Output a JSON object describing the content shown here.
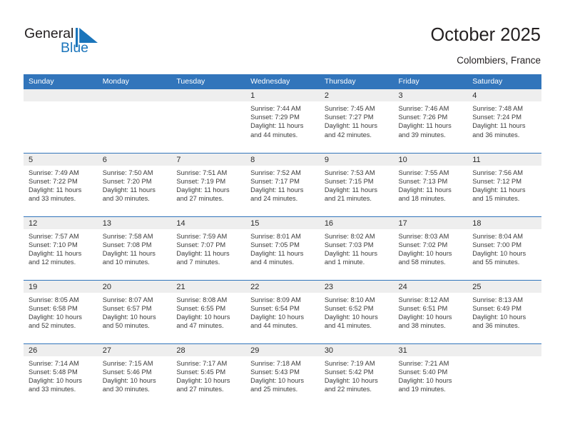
{
  "brand": {
    "name_part1": "General",
    "name_part2": "Blue",
    "logo_icon": "blue-flag-triangle-icon",
    "color_dark": "#231f20",
    "color_blue": "#1b75bb"
  },
  "header": {
    "title": "October 2025",
    "location": "Colombiers, France"
  },
  "theme": {
    "header_blue": "#3275bb",
    "daynum_band": "#eeeeee",
    "text": "#3b3b3b"
  },
  "weekdays": [
    "Sunday",
    "Monday",
    "Tuesday",
    "Wednesday",
    "Thursday",
    "Friday",
    "Saturday"
  ],
  "labels": {
    "sunrise_prefix": "Sunrise:",
    "sunset_prefix": "Sunset:",
    "daylight_prefix": "Daylight:"
  },
  "weeks": [
    [
      {
        "day": "",
        "empty": true
      },
      {
        "day": "",
        "empty": true
      },
      {
        "day": "",
        "empty": true
      },
      {
        "day": "1",
        "sunrise": "Sunrise: 7:44 AM",
        "sunset": "Sunset: 7:29 PM",
        "daylight_line1": "Daylight: 11 hours",
        "daylight_line2": "and 44 minutes."
      },
      {
        "day": "2",
        "sunrise": "Sunrise: 7:45 AM",
        "sunset": "Sunset: 7:27 PM",
        "daylight_line1": "Daylight: 11 hours",
        "daylight_line2": "and 42 minutes."
      },
      {
        "day": "3",
        "sunrise": "Sunrise: 7:46 AM",
        "sunset": "Sunset: 7:26 PM",
        "daylight_line1": "Daylight: 11 hours",
        "daylight_line2": "and 39 minutes."
      },
      {
        "day": "4",
        "sunrise": "Sunrise: 7:48 AM",
        "sunset": "Sunset: 7:24 PM",
        "daylight_line1": "Daylight: 11 hours",
        "daylight_line2": "and 36 minutes."
      }
    ],
    [
      {
        "day": "5",
        "sunrise": "Sunrise: 7:49 AM",
        "sunset": "Sunset: 7:22 PM",
        "daylight_line1": "Daylight: 11 hours",
        "daylight_line2": "and 33 minutes."
      },
      {
        "day": "6",
        "sunrise": "Sunrise: 7:50 AM",
        "sunset": "Sunset: 7:20 PM",
        "daylight_line1": "Daylight: 11 hours",
        "daylight_line2": "and 30 minutes."
      },
      {
        "day": "7",
        "sunrise": "Sunrise: 7:51 AM",
        "sunset": "Sunset: 7:19 PM",
        "daylight_line1": "Daylight: 11 hours",
        "daylight_line2": "and 27 minutes."
      },
      {
        "day": "8",
        "sunrise": "Sunrise: 7:52 AM",
        "sunset": "Sunset: 7:17 PM",
        "daylight_line1": "Daylight: 11 hours",
        "daylight_line2": "and 24 minutes."
      },
      {
        "day": "9",
        "sunrise": "Sunrise: 7:53 AM",
        "sunset": "Sunset: 7:15 PM",
        "daylight_line1": "Daylight: 11 hours",
        "daylight_line2": "and 21 minutes."
      },
      {
        "day": "10",
        "sunrise": "Sunrise: 7:55 AM",
        "sunset": "Sunset: 7:13 PM",
        "daylight_line1": "Daylight: 11 hours",
        "daylight_line2": "and 18 minutes."
      },
      {
        "day": "11",
        "sunrise": "Sunrise: 7:56 AM",
        "sunset": "Sunset: 7:12 PM",
        "daylight_line1": "Daylight: 11 hours",
        "daylight_line2": "and 15 minutes."
      }
    ],
    [
      {
        "day": "12",
        "sunrise": "Sunrise: 7:57 AM",
        "sunset": "Sunset: 7:10 PM",
        "daylight_line1": "Daylight: 11 hours",
        "daylight_line2": "and 12 minutes."
      },
      {
        "day": "13",
        "sunrise": "Sunrise: 7:58 AM",
        "sunset": "Sunset: 7:08 PM",
        "daylight_line1": "Daylight: 11 hours",
        "daylight_line2": "and 10 minutes."
      },
      {
        "day": "14",
        "sunrise": "Sunrise: 7:59 AM",
        "sunset": "Sunset: 7:07 PM",
        "daylight_line1": "Daylight: 11 hours",
        "daylight_line2": "and 7 minutes."
      },
      {
        "day": "15",
        "sunrise": "Sunrise: 8:01 AM",
        "sunset": "Sunset: 7:05 PM",
        "daylight_line1": "Daylight: 11 hours",
        "daylight_line2": "and 4 minutes."
      },
      {
        "day": "16",
        "sunrise": "Sunrise: 8:02 AM",
        "sunset": "Sunset: 7:03 PM",
        "daylight_line1": "Daylight: 11 hours",
        "daylight_line2": "and 1 minute."
      },
      {
        "day": "17",
        "sunrise": "Sunrise: 8:03 AM",
        "sunset": "Sunset: 7:02 PM",
        "daylight_line1": "Daylight: 10 hours",
        "daylight_line2": "and 58 minutes."
      },
      {
        "day": "18",
        "sunrise": "Sunrise: 8:04 AM",
        "sunset": "Sunset: 7:00 PM",
        "daylight_line1": "Daylight: 10 hours",
        "daylight_line2": "and 55 minutes."
      }
    ],
    [
      {
        "day": "19",
        "sunrise": "Sunrise: 8:05 AM",
        "sunset": "Sunset: 6:58 PM",
        "daylight_line1": "Daylight: 10 hours",
        "daylight_line2": "and 52 minutes."
      },
      {
        "day": "20",
        "sunrise": "Sunrise: 8:07 AM",
        "sunset": "Sunset: 6:57 PM",
        "daylight_line1": "Daylight: 10 hours",
        "daylight_line2": "and 50 minutes."
      },
      {
        "day": "21",
        "sunrise": "Sunrise: 8:08 AM",
        "sunset": "Sunset: 6:55 PM",
        "daylight_line1": "Daylight: 10 hours",
        "daylight_line2": "and 47 minutes."
      },
      {
        "day": "22",
        "sunrise": "Sunrise: 8:09 AM",
        "sunset": "Sunset: 6:54 PM",
        "daylight_line1": "Daylight: 10 hours",
        "daylight_line2": "and 44 minutes."
      },
      {
        "day": "23",
        "sunrise": "Sunrise: 8:10 AM",
        "sunset": "Sunset: 6:52 PM",
        "daylight_line1": "Daylight: 10 hours",
        "daylight_line2": "and 41 minutes."
      },
      {
        "day": "24",
        "sunrise": "Sunrise: 8:12 AM",
        "sunset": "Sunset: 6:51 PM",
        "daylight_line1": "Daylight: 10 hours",
        "daylight_line2": "and 38 minutes."
      },
      {
        "day": "25",
        "sunrise": "Sunrise: 8:13 AM",
        "sunset": "Sunset: 6:49 PM",
        "daylight_line1": "Daylight: 10 hours",
        "daylight_line2": "and 36 minutes."
      }
    ],
    [
      {
        "day": "26",
        "sunrise": "Sunrise: 7:14 AM",
        "sunset": "Sunset: 5:48 PM",
        "daylight_line1": "Daylight: 10 hours",
        "daylight_line2": "and 33 minutes."
      },
      {
        "day": "27",
        "sunrise": "Sunrise: 7:15 AM",
        "sunset": "Sunset: 5:46 PM",
        "daylight_line1": "Daylight: 10 hours",
        "daylight_line2": "and 30 minutes."
      },
      {
        "day": "28",
        "sunrise": "Sunrise: 7:17 AM",
        "sunset": "Sunset: 5:45 PM",
        "daylight_line1": "Daylight: 10 hours",
        "daylight_line2": "and 27 minutes."
      },
      {
        "day": "29",
        "sunrise": "Sunrise: 7:18 AM",
        "sunset": "Sunset: 5:43 PM",
        "daylight_line1": "Daylight: 10 hours",
        "daylight_line2": "and 25 minutes."
      },
      {
        "day": "30",
        "sunrise": "Sunrise: 7:19 AM",
        "sunset": "Sunset: 5:42 PM",
        "daylight_line1": "Daylight: 10 hours",
        "daylight_line2": "and 22 minutes."
      },
      {
        "day": "31",
        "sunrise": "Sunrise: 7:21 AM",
        "sunset": "Sunset: 5:40 PM",
        "daylight_line1": "Daylight: 10 hours",
        "daylight_line2": "and 19 minutes."
      },
      {
        "day": "",
        "empty": true
      }
    ]
  ]
}
